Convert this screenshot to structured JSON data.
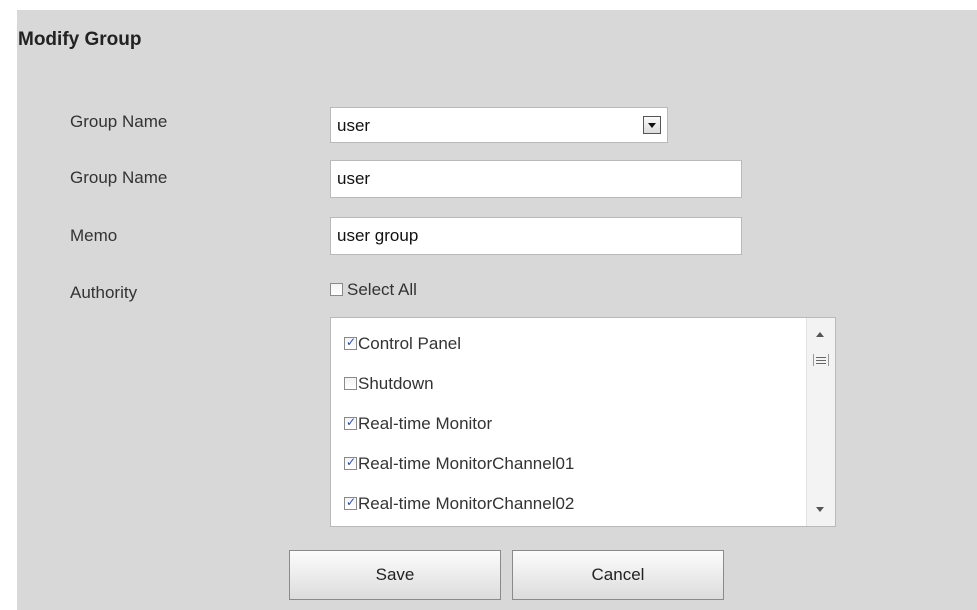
{
  "title": "Modify Group",
  "form": {
    "group_select_label": "Group Name",
    "group_select_value": "user",
    "group_name_label": "Group Name",
    "group_name_value": "user",
    "memo_label": "Memo",
    "memo_value": "user group",
    "authority_label": "Authority",
    "select_all_label": "Select All",
    "select_all_checked": false
  },
  "authority_items": [
    {
      "label": "Control Panel",
      "checked": true
    },
    {
      "label": "Shutdown",
      "checked": false
    },
    {
      "label": "Real-time Monitor",
      "checked": true
    },
    {
      "label": "Real-time MonitorChannel01",
      "checked": true
    },
    {
      "label": "Real-time MonitorChannel02",
      "checked": true
    }
  ],
  "buttons": {
    "save": "Save",
    "cancel": "Cancel"
  }
}
